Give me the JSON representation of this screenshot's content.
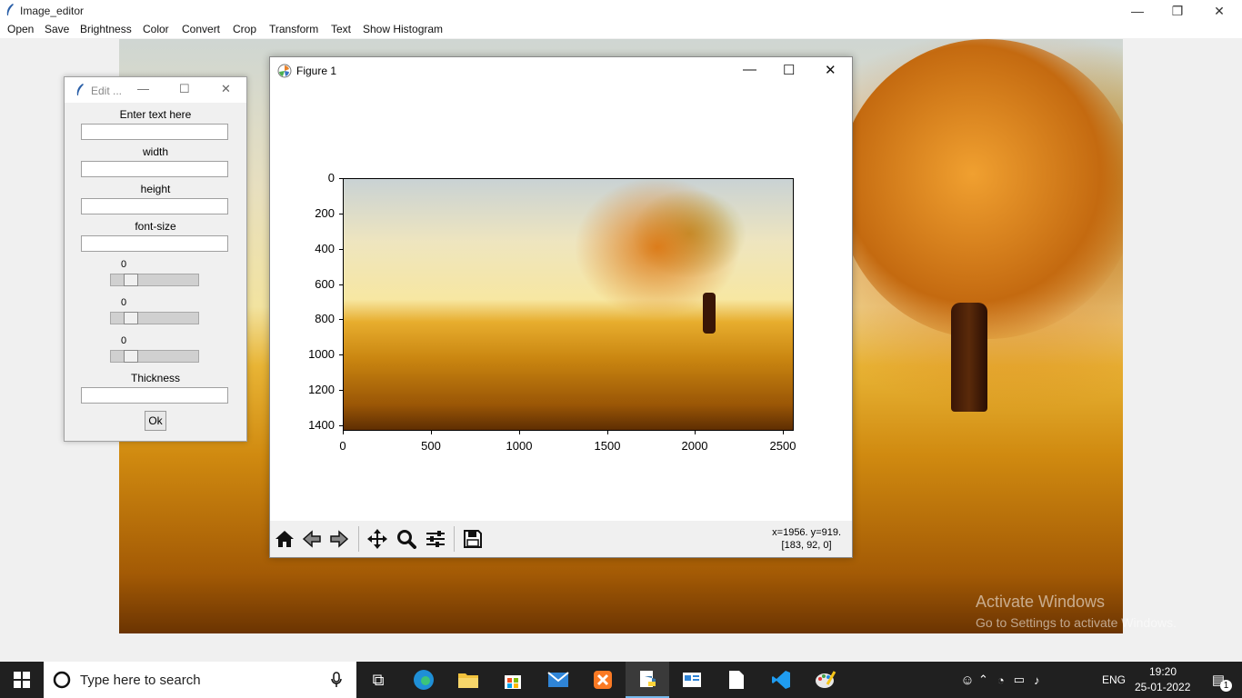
{
  "app": {
    "title": "Image_editor"
  },
  "menu": [
    "Open",
    "Save",
    "Brightness",
    "Color",
    "Convert",
    "Crop",
    "Transform",
    "Text",
    "Show Histogram"
  ],
  "edit_window": {
    "title": "Edit ...",
    "fields": [
      {
        "label": "Enter text here",
        "value": ""
      },
      {
        "label": "width",
        "value": ""
      },
      {
        "label": "height",
        "value": ""
      },
      {
        "label": "font-size",
        "value": ""
      }
    ],
    "sliders": [
      {
        "value": "0"
      },
      {
        "value": "0"
      },
      {
        "value": "0"
      }
    ],
    "thickness": {
      "label": "Thickness",
      "value": ""
    },
    "ok_label": "Ok"
  },
  "figure": {
    "title": "Figure 1",
    "y_ticks": [
      "0",
      "200",
      "400",
      "600",
      "800",
      "1000",
      "1200",
      "1400"
    ],
    "x_ticks": [
      "0",
      "500",
      "1000",
      "1500",
      "2000",
      "2500"
    ],
    "coords_line1": "x=1956. y=919.",
    "coords_line2": "[183, 92, 0]",
    "toolbar": [
      "home-icon",
      "back-icon",
      "forward-icon",
      "pan-icon",
      "zoom-icon",
      "configure-icon",
      "save-icon"
    ]
  },
  "watermark": {
    "line1": "Activate Windows",
    "line2": "Go to Settings to activate Windows."
  },
  "taskbar": {
    "search_placeholder": "Type here to search",
    "language": "ENG",
    "time": "19:20",
    "date": "25-01-2022",
    "notification_count": "1"
  }
}
